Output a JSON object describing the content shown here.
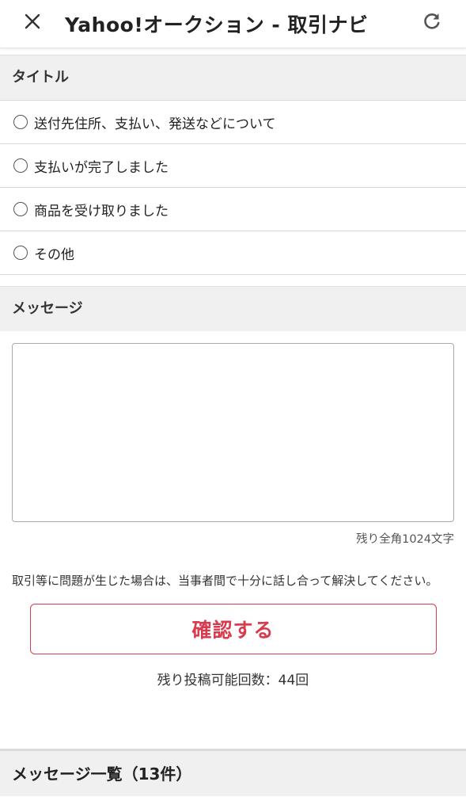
{
  "header": {
    "close_icon": "close-icon",
    "title": "Yahoo!オークション - 取引ナビ",
    "reload_icon": "reload-icon"
  },
  "title_section": {
    "heading": "タイトル",
    "options": [
      {
        "label": "送付先住所、支払い、発送などについて",
        "selected": false
      },
      {
        "label": "支払いが完了しました",
        "selected": false
      },
      {
        "label": "商品を受け取りました",
        "selected": false
      },
      {
        "label": "その他",
        "selected": false
      }
    ]
  },
  "message_section": {
    "heading": "メッセージ",
    "input_value": "",
    "char_counter": "残り全角1024文字"
  },
  "notice": "取引等に問題が生じた場合は、当事者間で十分に話し合って解決してください。",
  "confirm_button": "確認する",
  "remaining_posts": "残り投稿可能回数：44回",
  "message_list": {
    "heading": "メッセージ一覧（13件）"
  },
  "colors": {
    "accent": "#d83a4e",
    "section_bg": "#f0f0f0",
    "divider": "#d8d8d8"
  }
}
